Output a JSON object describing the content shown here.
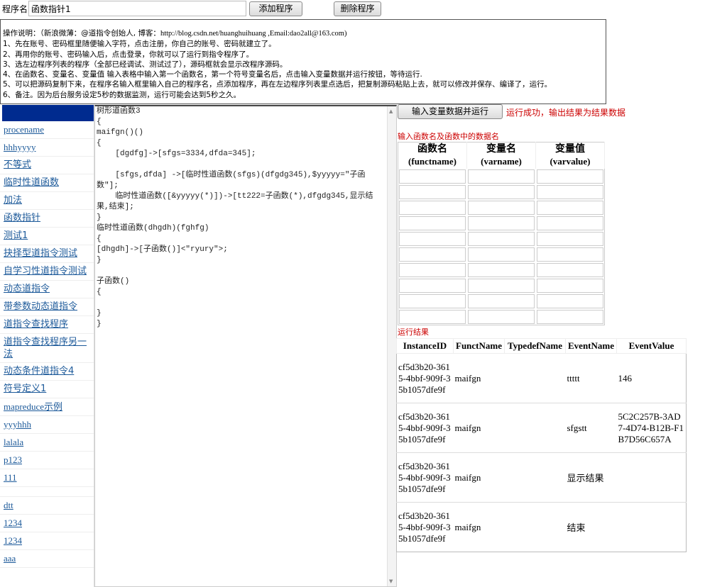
{
  "top": {
    "name_label": "程序名",
    "name_value": "函数指针1",
    "add_button": "添加程序",
    "delete_button": "删除程序"
  },
  "instructions": {
    "intro_cn": "操作说明：（新浪微薄：@道指令创始人, 博客：",
    "intro_en": "http://blog.csdn.net/huanghuihuang ,Email:dao2all@163.com)",
    "lines": [
      "1、先在账号、密码框里随便输入字符，点击注册，你自己的账号、密码就建立了。",
      "2、再用你的账号、密码输入后，点击登录，你就可以了运行到指令程序了。",
      "3、选左边程序列表的程序（全部已经调试、测试过了），源码框就会显示改程序源码。",
      "4、在函数名、变量名、变量值 输入表格中输入第一个函数名，第一个符号变量名后，点击输入变量数据并运行按钮，等待运行.",
      "5、可以把源码复制下来，在程序名输入框里输入自己的程序名，点添加程序，再在左边程序列表里点选后，把复制源码粘贴上去，就可以修改并保存、编译了，运行。",
      "6、备注。因为后台服务设定5秒的数据监测，运行可能会达到5秒之久。"
    ]
  },
  "sidebar": {
    "items": [
      "procename",
      "hhhyyyy",
      "不等式",
      "临时性道函数",
      "加法",
      "函数指针",
      "测试1",
      "抉择型道指令测试",
      "自学习性道指令测试",
      "动态道指令",
      "带参数动态道指令",
      "道指令查找程序",
      "道指令查找程序另一法",
      "动态条件道指令4",
      "符号定义1",
      "mapreduce示例",
      "yyyhhh",
      "lalala",
      "p123",
      "111",
      "",
      "dtt",
      "1234",
      "1234",
      "aaa"
    ]
  },
  "code": "树形道函数3\n{\nmaifgn()()\n{\n    [dgdfg]->[sfgs=3334,dfda=345];\n\n    [sfgs,dfda] ->[临时性道函数(sfgs)(dfgdg345),$yyyyy=\"子函数\"];\n    临时性道函数([&yyyyy(*)])->[tt222=子函数(*),dfgdg345,显示结果,结束];\n}\n临时性道函数(dhgdh)(fghfg)\n{\n[dhgdh]->[子函数()]<\"ryury\">;\n}\n\n子函数()\n{\n\n}\n}",
  "run": {
    "button": "输入变量数据并运行",
    "status": "运行成功，输出结果为结果数据",
    "status_color": "#cc0000"
  },
  "input_table": {
    "title": "输入函数名及函数中的数据名",
    "headers": [
      {
        "cn": "函数名",
        "en": "(functname)"
      },
      {
        "cn": "变量名",
        "en": "(varname)"
      },
      {
        "cn": "变量值",
        "en": "(varvalue)"
      }
    ],
    "row_count": 10
  },
  "results": {
    "title": "运行结果",
    "headers": [
      "InstanceID",
      "FunctName",
      "TypedefName",
      "EventName",
      "EventValue"
    ],
    "rows": [
      [
        "cf5d3b20-3615-4bbf-909f-35b1057dfe9f",
        "maifgn",
        "",
        "ttttt",
        "146"
      ],
      [
        "cf5d3b20-3615-4bbf-909f-35b1057dfe9f",
        "maifgn",
        "",
        "sfgstt",
        "5C2C257B-3AD7-4D74-B12B-F1B7D56C657A"
      ],
      [
        "cf5d3b20-3615-4bbf-909f-35b1057dfe9f",
        "maifgn",
        "",
        "显示结果",
        ""
      ],
      [
        "cf5d3b20-3615-4bbf-909f-35b1057dfe9f",
        "maifgn",
        "",
        "结束",
        ""
      ]
    ]
  }
}
